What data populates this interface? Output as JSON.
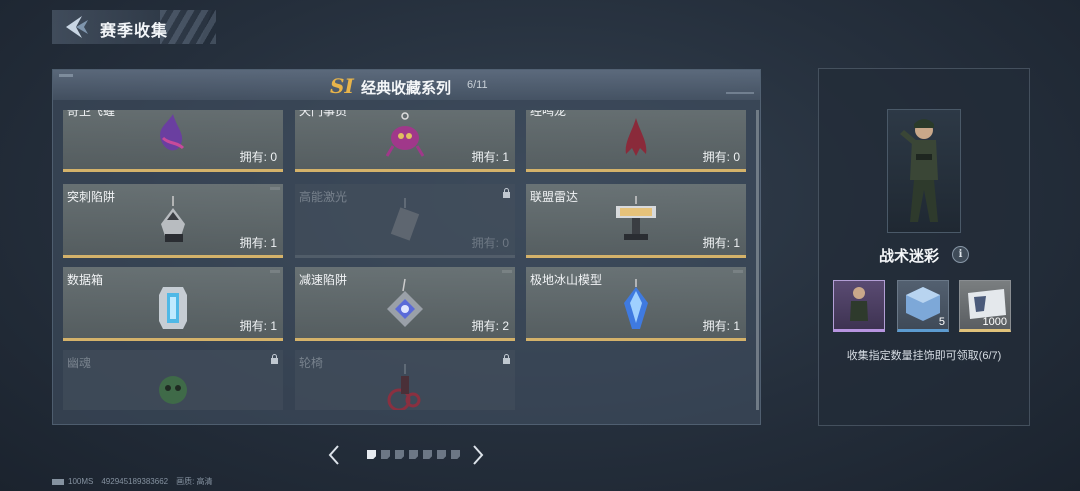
{
  "header": {
    "title": "赛季收集"
  },
  "series": {
    "badge": "SI",
    "title": "经典收藏系列",
    "count": "6/11"
  },
  "cards": [
    {
      "name": "奇卫飞蝗",
      "owned": "拥有: 0",
      "locked": false
    },
    {
      "name": "天门事员",
      "owned": "拥有: 1",
      "locked": false
    },
    {
      "name": "经鸣龙",
      "owned": "拥有: 0",
      "locked": false
    },
    {
      "name": "突刺陷阱",
      "owned": "拥有: 1",
      "locked": false
    },
    {
      "name": "高能激光",
      "owned": "拥有: 0",
      "locked": true
    },
    {
      "name": "联盟雷达",
      "owned": "拥有: 1",
      "locked": false
    },
    {
      "name": "数据箱",
      "owned": "拥有: 1",
      "locked": false
    },
    {
      "name": "减速陷阱",
      "owned": "拥有: 2",
      "locked": false
    },
    {
      "name": "极地冰山模型",
      "owned": "拥有: 1",
      "locked": false
    },
    {
      "name": "幽魂",
      "owned": "",
      "locked": true
    },
    {
      "name": "轮椅",
      "owned": "",
      "locked": true
    }
  ],
  "pager": {
    "total_pages": 7,
    "current": 1
  },
  "reward": {
    "name": "战术迷彩",
    "info_icon": "i",
    "items": [
      {
        "qty": "",
        "icon": "character-portrait-icon"
      },
      {
        "qty": "5",
        "icon": "supply-crate-icon"
      },
      {
        "qty": "1000",
        "icon": "ticket-icon"
      }
    ],
    "note": "收集指定数量挂饰即可领取(6/7)"
  },
  "footer": {
    "ping": "100MS",
    "id": "492945189383662",
    "quality": "画质: 高清"
  },
  "colors": {
    "gold_accent": "#d4b26a",
    "badge_gold": "#e8b44a",
    "rare_purple": "#b794e0",
    "rare_blue": "#5c9bd0"
  }
}
